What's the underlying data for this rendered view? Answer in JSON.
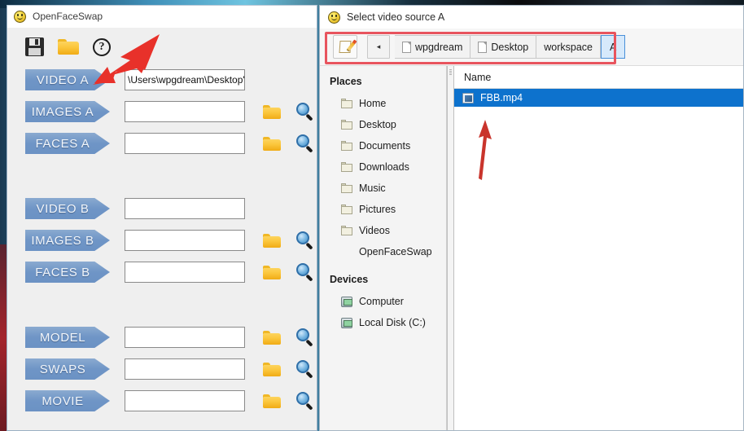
{
  "app": {
    "title": "OpenFaceSwap",
    "icon": "smiley-icon",
    "toolbar": {
      "save_label": "save-icon",
      "open_label": "folder-icon",
      "help_label": "?"
    },
    "rows": [
      {
        "label": "VIDEO A",
        "value": "\\Users\\wpgdream\\Desktop'",
        "has_icons": false
      },
      {
        "label": "IMAGES A",
        "value": "",
        "has_icons": true
      },
      {
        "label": "FACES A",
        "value": "",
        "has_icons": true
      },
      {
        "label": "VIDEO B",
        "value": "",
        "has_icons": false
      },
      {
        "label": "IMAGES B",
        "value": "",
        "has_icons": true
      },
      {
        "label": "FACES B",
        "value": "",
        "has_icons": true
      },
      {
        "label": "MODEL",
        "value": "",
        "has_icons": true
      },
      {
        "label": "SWAPS",
        "value": "",
        "has_icons": true
      },
      {
        "label": "MOVIE",
        "value": "",
        "has_icons": true
      }
    ]
  },
  "chooser": {
    "title": "Select video source A",
    "icon": "smiley-icon",
    "breadcrumb": {
      "edit_button": "edit-path-icon",
      "back_button": "◂",
      "items": [
        {
          "label": "wpgdream",
          "has_file_icon": true,
          "active": false
        },
        {
          "label": "Desktop",
          "has_file_icon": true,
          "active": false
        },
        {
          "label": "workspace",
          "has_file_icon": false,
          "active": false
        },
        {
          "label": "A",
          "has_file_icon": false,
          "active": true
        }
      ]
    },
    "places": {
      "heading_places": "Places",
      "heading_devices": "Devices",
      "items": [
        {
          "label": "Home",
          "icon": "folder-icon"
        },
        {
          "label": "Desktop",
          "icon": "folder-icon"
        },
        {
          "label": "Documents",
          "icon": "folder-icon"
        },
        {
          "label": "Downloads",
          "icon": "folder-icon"
        },
        {
          "label": "Music",
          "icon": "folder-icon"
        },
        {
          "label": "Pictures",
          "icon": "folder-icon"
        },
        {
          "label": "Videos",
          "icon": "folder-icon"
        },
        {
          "label": "OpenFaceSwap",
          "icon": "none"
        }
      ],
      "devices": [
        {
          "label": "Computer",
          "icon": "drive-icon"
        },
        {
          "label": "Local Disk (C:)",
          "icon": "drive-icon"
        }
      ]
    },
    "filelist": {
      "column_header": "Name",
      "files": [
        {
          "name": "FBB.mp4",
          "icon": "video-file-icon",
          "selected": true
        }
      ]
    }
  },
  "annotations": {
    "accent_red": "#e03a3a",
    "highlight_box_color": "#e8545e",
    "selection_blue": "#0d72cd",
    "crumb_active_blue": "#d6e9fb",
    "chevron_blue": "#6f95c6"
  }
}
